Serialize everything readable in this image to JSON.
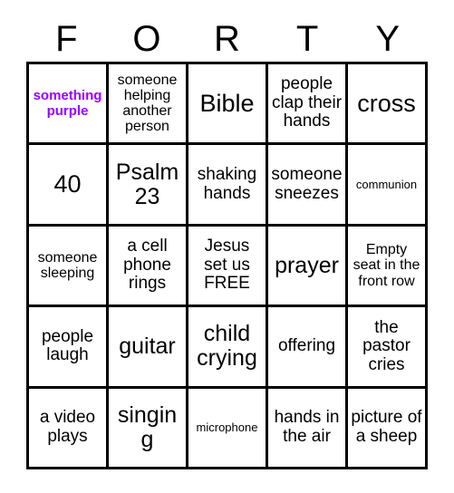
{
  "card": {
    "title_letters": [
      "F",
      "O",
      "R",
      "T",
      "Y"
    ],
    "accent_color": "#9900ff",
    "border_color": "#000000",
    "background_color": "#ffffff",
    "rows": [
      [
        {
          "label": "something purple",
          "style": "purple"
        },
        {
          "label": "someone helping another person",
          "style": "sm"
        },
        {
          "label": "Bible",
          "style": "xl"
        },
        {
          "label": "people clap their hands",
          "style": "md"
        },
        {
          "label": "cross",
          "style": "xl"
        }
      ],
      [
        {
          "label": "40",
          "style": "xl"
        },
        {
          "label": "Psalm 23",
          "style": "lg"
        },
        {
          "label": "shaking hands",
          "style": "md"
        },
        {
          "label": "someone sneezes",
          "style": "md"
        },
        {
          "label": "communion",
          "style": "xs"
        }
      ],
      [
        {
          "label": "someone sleeping",
          "style": "sm"
        },
        {
          "label": "a cell phone rings",
          "style": "md"
        },
        {
          "label": "Jesus set us FREE",
          "style": "md"
        },
        {
          "label": "prayer",
          "style": "lg"
        },
        {
          "label": "Empty seat in the front row",
          "style": "sm"
        }
      ],
      [
        {
          "label": "people laugh",
          "style": "md"
        },
        {
          "label": "guitar",
          "style": "lg"
        },
        {
          "label": "child crying",
          "style": "lg"
        },
        {
          "label": "offering",
          "style": "md"
        },
        {
          "label": "the pastor cries",
          "style": "md"
        }
      ],
      [
        {
          "label": "a video plays",
          "style": "md"
        },
        {
          "label": "singing",
          "style": "lg"
        },
        {
          "label": "microphone",
          "style": "xs"
        },
        {
          "label": "hands in the air",
          "style": "md"
        },
        {
          "label": "picture of a sheep",
          "style": "md"
        }
      ]
    ]
  }
}
